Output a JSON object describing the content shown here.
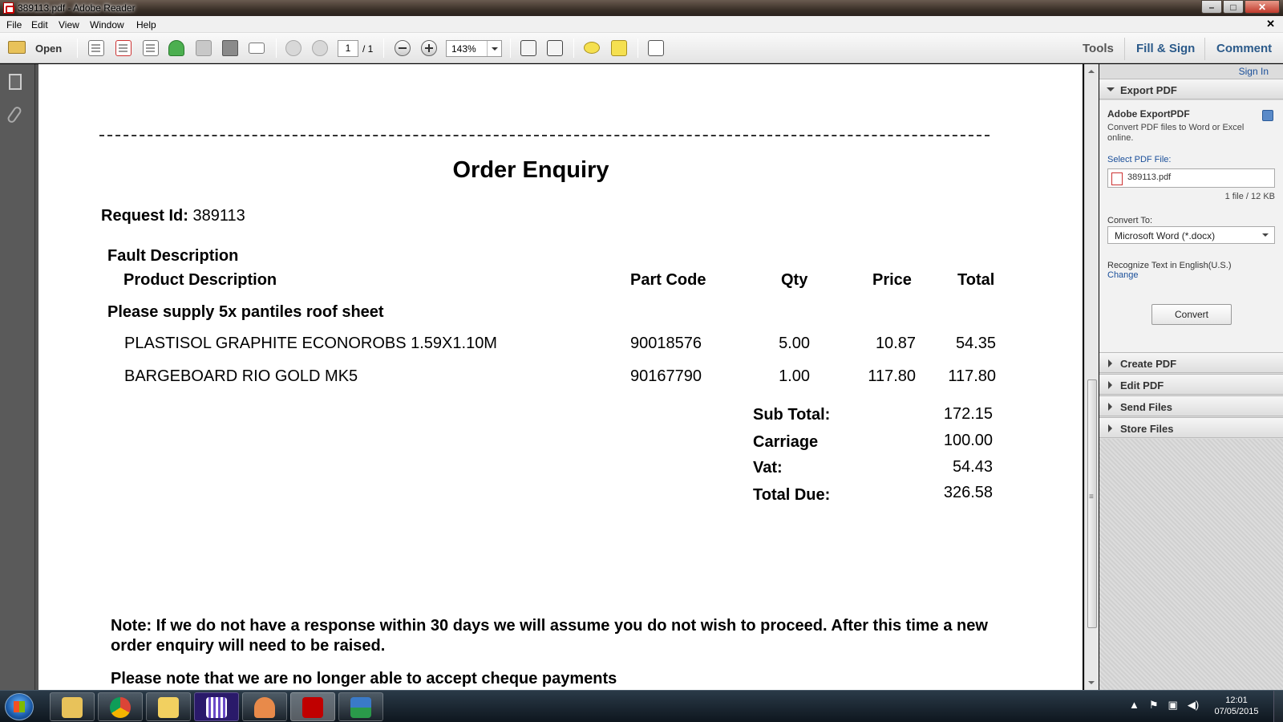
{
  "window": {
    "title": "389113.pdf - Adobe Reader",
    "min_glyph": "–",
    "max_glyph": "□",
    "close_glyph": "✕",
    "doc_close_glyph": "✕"
  },
  "menu": [
    "File",
    "Edit",
    "View",
    "Window",
    "Help"
  ],
  "toolbar": {
    "open_label": "Open",
    "page_current": "1",
    "page_total": "/ 1",
    "zoom": "143%",
    "tabs": {
      "tools": "Tools",
      "fill_sign": "Fill & Sign",
      "comment": "Comment"
    }
  },
  "document": {
    "title": "Order Enquiry",
    "request_label": "Request Id:",
    "request_id": "389113",
    "fault_heading": "Fault Description",
    "columns": {
      "product": "Product Description",
      "part_code": "Part Code",
      "qty": "Qty",
      "price": "Price",
      "total": "Total"
    },
    "fault_text": "Please supply 5x pantiles roof sheet",
    "lines": [
      {
        "desc": "PLASTISOL GRAPHITE ECONOROBS 1.59X1.10M",
        "part_code": "90018576",
        "qty": "5.00",
        "price": "10.87",
        "total": "54.35"
      },
      {
        "desc": "BARGEBOARD RIO GOLD MK5",
        "part_code": "90167790",
        "qty": "1.00",
        "price": "117.80",
        "total": "117.80"
      }
    ],
    "summary": [
      {
        "label": "Sub Total:",
        "value": "172.15"
      },
      {
        "label": "Carriage",
        "value": "100.00"
      },
      {
        "label": "Vat:",
        "value": "54.43"
      },
      {
        "label": "Total Due:",
        "value": "326.58"
      }
    ],
    "note": "Note: If we do not have a response within 30 days we will assume you do not wish to proceed. After this time a new order enquiry will need to be raised.",
    "note2": "Please note that we are no longer able to accept cheque payments"
  },
  "right_panel": {
    "sign_in": "Sign In",
    "export_section": "Export PDF",
    "export_title": "Adobe ExportPDF",
    "export_desc": "Convert PDF files to Word or Excel online.",
    "select_label": "Select PDF File:",
    "file_name": "389113.pdf",
    "file_info": "1 file / 12 KB",
    "convert_to_label": "Convert To:",
    "convert_to_value": "Microsoft Word (*.docx)",
    "recognize_text": "Recognize Text in English(U.S.)",
    "change_link": "Change",
    "convert_button": "Convert",
    "sections": [
      "Create PDF",
      "Edit PDF",
      "Send Files",
      "Store Files"
    ]
  },
  "taskbar": {
    "time": "12:01",
    "date": "07/05/2015",
    "apps": [
      "file-explorer",
      "chrome",
      "outlook",
      "calendar-app",
      "contacts-app",
      "adobe-reader",
      "sage"
    ]
  },
  "colors": {
    "accent_link": "#1a4f9a",
    "reader_red": "#c00000"
  }
}
